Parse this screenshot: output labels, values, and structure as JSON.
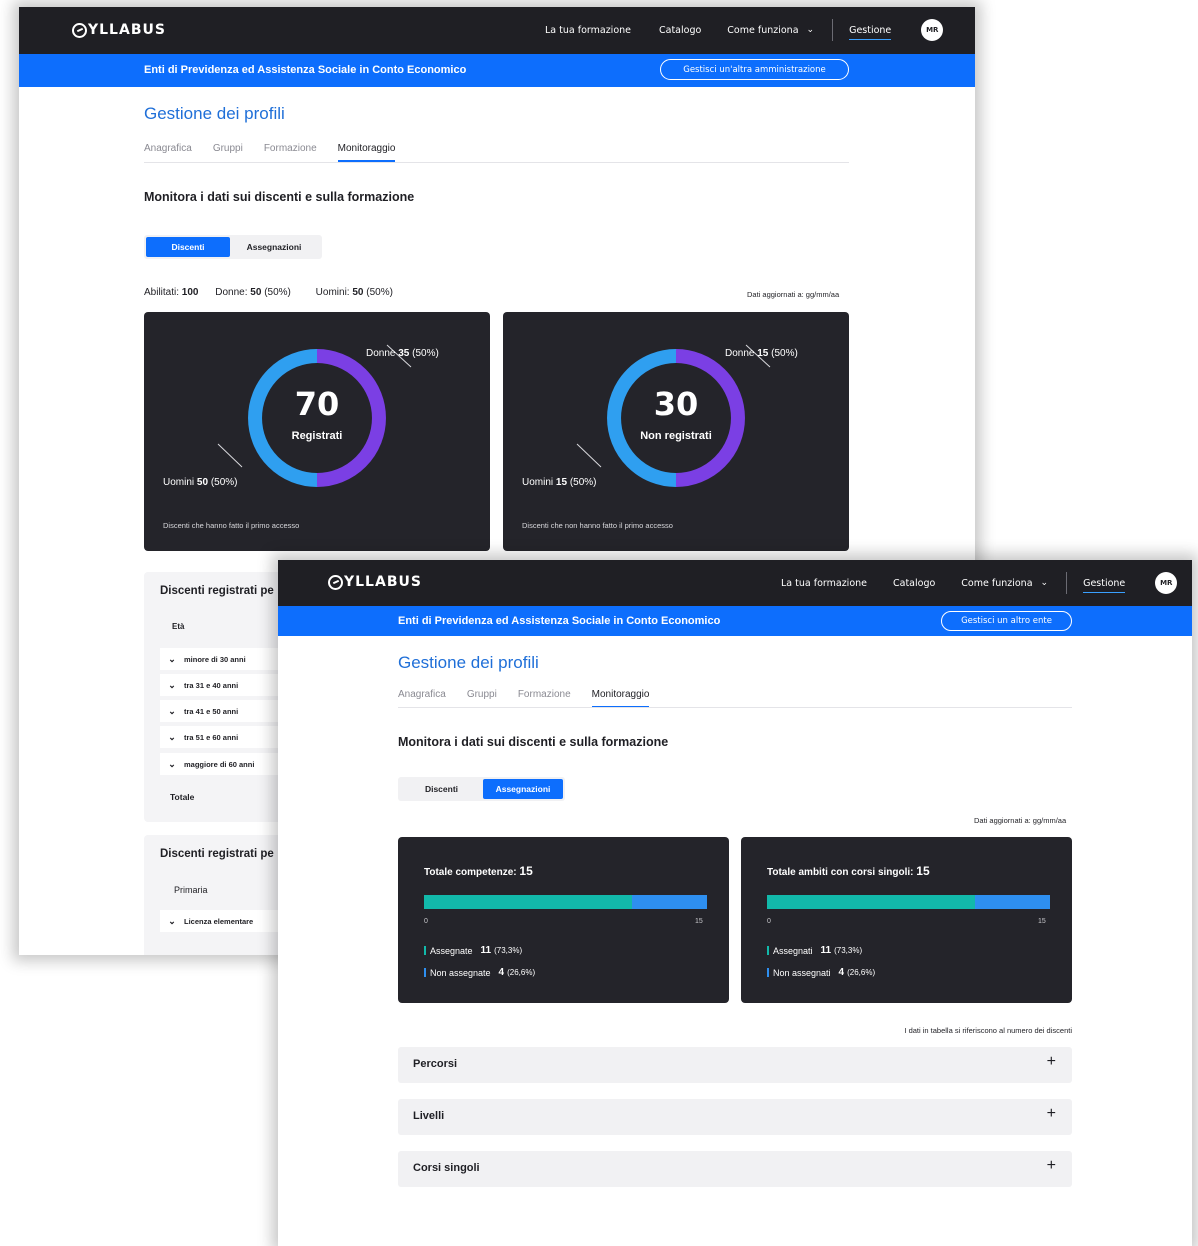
{
  "common": {
    "brand": "YLLABUS",
    "nav": {
      "la_tua_formazione": "La tua formazione",
      "catalogo": "Catalogo",
      "come_funziona": "Come funziona",
      "chevron": "⌄",
      "gestione": "Gestione",
      "avatar": "MR"
    },
    "org_name": "Enti di Previdenza ed Assistenza Sociale in Conto Economico",
    "page_title": "Gestione dei profili",
    "tabs": [
      "Anagrafica",
      "Gruppi",
      "Formazione",
      "Monitoraggio"
    ],
    "section_title": "Monitora i dati sui discenti e sulla formazione",
    "segmented": [
      "Discenti",
      "Assegnazioni"
    ],
    "updated": "Dati aggiornati a: gg/mm/aa"
  },
  "screen1": {
    "switch_label": "Gestisci un'altra amministrazione",
    "summary": {
      "abilitati_label": "Abilitati:",
      "abilitati_value": "100",
      "donne_label": "Donne:",
      "donne_value": "50",
      "donne_pct": "(50%)",
      "uomini_label": "Uomini:",
      "uomini_value": "50",
      "uomini_pct": "(50%)"
    },
    "card_registrati": {
      "value": "70",
      "label": "Registrati",
      "donne_label": "Donne",
      "donne_value": "35",
      "donne_pct": "(50%)",
      "uomini_label": "Uomini",
      "uomini_value": "50",
      "uomini_pct": "(50%)",
      "footer": "Discenti che hanno fatto il primo accesso"
    },
    "card_non_registrati": {
      "value": "30",
      "label": "Non registrati",
      "donne_label": "Donne",
      "donne_value": "15",
      "donne_pct": "(50%)",
      "uomini_label": "Uomini",
      "uomini_value": "15",
      "uomini_pct": "(50%)",
      "footer": "Discenti che non hanno fatto il primo accesso"
    },
    "table_age": {
      "title": "Discenti registrati pe",
      "head": "Età",
      "rows": [
        "minore di 30 anni",
        "tra 31 e 40 anni",
        "tra 41 e 50 anni",
        "tra 51 e 60 anni",
        "maggiore di 60 anni"
      ],
      "total": "Totale"
    },
    "table_edu": {
      "title": "Discenti registrati pe",
      "group": "Primaria",
      "row": "Licenza elementare"
    }
  },
  "screen2": {
    "switch_label": "Gestisci un altro ente",
    "card_competenze": {
      "title": "Totale competenze:",
      "total": "15",
      "assigned_label": "Assegnate",
      "assigned_value": "11",
      "assigned_pct": "(73,3%)",
      "unassigned_label": "Non assegnate",
      "unassigned_value": "4",
      "unassigned_pct": "(26,6%)",
      "axis_min": "0",
      "axis_max": "15"
    },
    "card_ambiti": {
      "title": "Totale ambiti con corsi singoli:",
      "total": "15",
      "assigned_label": "Assegnati",
      "assigned_value": "11",
      "assigned_pct": "(73,3%)",
      "unassigned_label": "Non assegnati",
      "unassigned_value": "4",
      "unassigned_pct": "(26,6%)",
      "axis_min": "0",
      "axis_max": "15"
    },
    "table_note": "I dati in tabella si riferiscono al numero dei discenti",
    "accordions": [
      "Percorsi",
      "Livelli",
      "Corsi singoli"
    ],
    "accordion_icon": "+"
  },
  "colors": {
    "navbar": "#1f1f24",
    "accent_blue": "#0d6efd",
    "donut_women": "#7b3fe4",
    "donut_men": "#2f9ff0",
    "bar_assigned": "#12b9aa",
    "bar_unassigned": "#2e8ff0"
  },
  "chart_data": [
    {
      "type": "pie",
      "title": "Registrati",
      "categories": [
        "Donne",
        "Uomini"
      ],
      "values": [
        35,
        50
      ]
    },
    {
      "type": "pie",
      "title": "Non registrati",
      "categories": [
        "Donne",
        "Uomini"
      ],
      "values": [
        15,
        15
      ]
    },
    {
      "type": "bar",
      "title": "Totale competenze: 15",
      "categories": [
        "Assegnate",
        "Non assegnate"
      ],
      "values": [
        11,
        4
      ],
      "ylim": [
        0,
        15
      ]
    },
    {
      "type": "bar",
      "title": "Totale ambiti con corsi singoli: 15",
      "categories": [
        "Assegnati",
        "Non assegnati"
      ],
      "values": [
        11,
        4
      ],
      "ylim": [
        0,
        15
      ]
    }
  ]
}
